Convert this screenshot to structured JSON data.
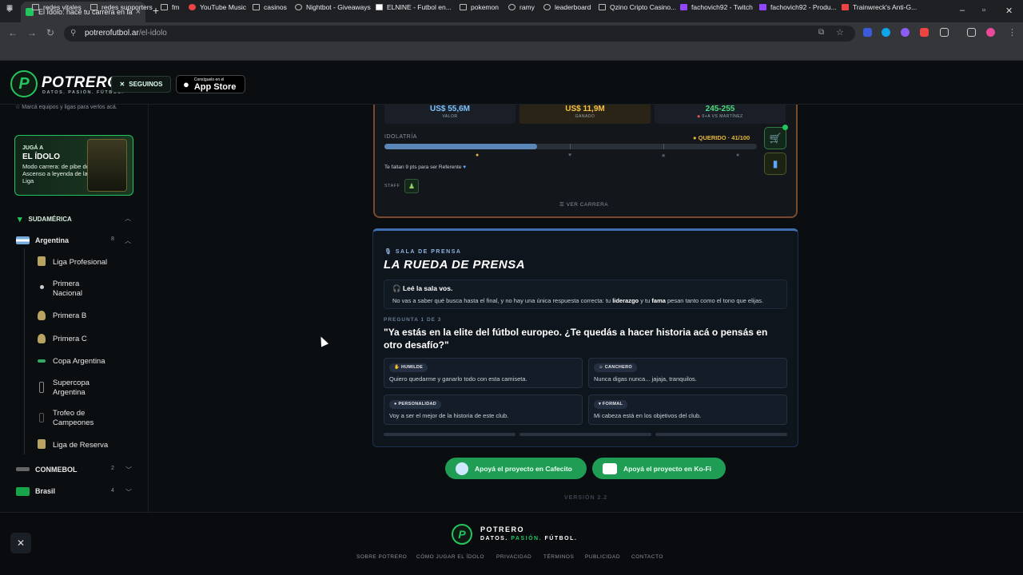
{
  "browser": {
    "tab_title": "El Ídolo: hacé tu carrera en la Li",
    "url_site": "potrerofutbol.ar",
    "url_path": "/el-idolo",
    "bookmarks": [
      "redes vitales",
      "redes supporters",
      "fm",
      "YouTube Music",
      "casinos",
      "Nightbot - Giveaways",
      "ELNINE - Futbol en...",
      "pokemon",
      "ramy",
      "leaderboard",
      "Qzino Cripto Casino...",
      "fachovich92 - Twitch",
      "fachovich92 - Produ...",
      "Trainwreck's Anti-G..."
    ]
  },
  "header": {
    "brand": "POTRERO",
    "tagline": "DATOS. PASIÓN. FÚTBOL.",
    "follow_label": "SEGUINOS",
    "app_small": "Consíguelo en el",
    "app_large": "App Store"
  },
  "sidebar": {
    "hint": "Marcá equipos y ligas para verlos acá.",
    "promo_kicker": "JUGÁ A",
    "promo_title": "EL ÍDOLO",
    "promo_text": "Modo carrera: de pibe del Ascenso a leyenda de la Liga",
    "region": "SUDAMÉRICA",
    "country": "Argentina",
    "country_count": "8",
    "leagues": [
      "Liga Profesional",
      "Primera Nacional",
      "Primera B",
      "Primera C",
      "Copa Argentina",
      "Supercopa Argentina",
      "Trofeo de Campeones",
      "Liga de Reserva"
    ],
    "conmebol": "CONMEBOL",
    "conmebol_count": "2",
    "brasil": "Brasil",
    "brasil_count": "4"
  },
  "career": {
    "valor_value": "US$ 55,6M",
    "valor_label": "VALOR",
    "ganado_value": "US$ 11,9M",
    "ganado_label": "GANADO",
    "record_value": "245-255",
    "record_label": "0+A VS MARTÍNEZ",
    "idolatria_label": "IDOLATRÍA",
    "querido": "QUERIDO · 41/100",
    "idolatria_progress": 0.41,
    "falta": "Te faltan 9 pts para ser Referente",
    "staff_label": "STAFF",
    "ver_carrera": "VER CARRERA"
  },
  "press": {
    "kicker": "SALA DE PRENSA",
    "title": "LA RUEDA DE PRENSA",
    "note_title": "Leé la sala vos.",
    "note_pre": "No vas a saber qué busca hasta el final, y no hay una única respuesta correcta: tu",
    "note_b1": "liderazgo",
    "note_mid": "y tu",
    "note_b2": "fama",
    "note_post": "pesan tanto como el tono que elijas.",
    "question_num": "PREGUNTA 1 DE 3",
    "question": "\"Ya estás en la elite del fútbol europeo. ¿Te quedás a hacer historia acá o pensás en otro desafío?\"",
    "options": [
      {
        "tag": "HUMILDE",
        "text": "Quiero quedarme y ganarlo todo con esta camiseta."
      },
      {
        "tag": "CANCHERO",
        "text": "Nunca digas nunca... jajaja, tranquilos."
      },
      {
        "tag": "PERSONALIDAD",
        "text": "Voy a ser el mejor de la historia de este club."
      },
      {
        "tag": "FORMAL",
        "text": "Mi cabeza está en los objetivos del club."
      }
    ]
  },
  "support": {
    "cafecito": "Apoyá el proyecto en Cafecito",
    "kofi": "Apoyá el proyecto en Ko-Fi",
    "version": "VERSIÓN 2.2"
  },
  "footer": {
    "brand": "POTRERO",
    "tag_a": "DATOS.",
    "tag_b": "PASIÓN.",
    "tag_c": "FÚTBOL.",
    "links": [
      "SOBRE POTRERO",
      "CÓMO JUGAR EL ÍDOLO",
      "PRIVACIDAD",
      "TÉRMINOS",
      "PUBLICIDAD",
      "CONTACTO"
    ]
  },
  "colors": {
    "accent": "#22c55e",
    "press_border": "#3f6fb0",
    "card_border": "#7a4a2c"
  }
}
